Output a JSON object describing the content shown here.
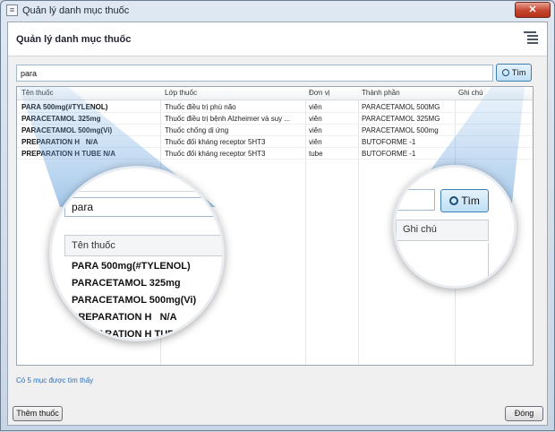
{
  "window": {
    "title": "Quản lý danh mục thuốc",
    "close_label": "✕"
  },
  "header": {
    "title": "Quản lý danh mục thuốc"
  },
  "search": {
    "value": "para",
    "button_label": "Tìm"
  },
  "table": {
    "columns": [
      "Tên thuốc",
      "Lớp thuốc",
      "Đơn vị",
      "Thành phần",
      "Ghi chú"
    ],
    "rows": [
      {
        "name": "PARA 500mg(#TYLENOL)",
        "class": "Thuốc điều trị phù não",
        "unit": "viên",
        "ingredient": "PARACETAMOL 500MG",
        "note": ""
      },
      {
        "name": "PARACETAMOL 325mg",
        "class": "Thuốc điều trị bệnh Alzheimer và suy ...",
        "unit": "viên",
        "ingredient": "PARACETAMOL 325MG",
        "note": ""
      },
      {
        "name": "PARACETAMOL 500mg(Vi)",
        "class": "Thuốc chống dị ứng",
        "unit": "viên",
        "ingredient": "PARACETAMOL 500mg",
        "note": ""
      },
      {
        "name": "PREPARATION H   N/A",
        "class": "Thuốc đối kháng receptor 5HT3",
        "unit": "viên",
        "ingredient": "BUTOFORME -1",
        "note": ""
      },
      {
        "name": "PREPARATION H TUBE N/A",
        "class": "Thuốc đối kháng receptor 5HT3",
        "unit": "tube",
        "ingredient": "BUTOFORME -1",
        "note": ""
      }
    ]
  },
  "status": {
    "text": "Có 5 mục được tìm thấy"
  },
  "footer": {
    "add_label": "Thêm thuốc",
    "close_label": "Đóng"
  },
  "zoom_left": {
    "search_value": "para",
    "header": "Tên thuốc",
    "rows": [
      "PARA 500mg(#TYLENOL)",
      "PARACETAMOL 325mg",
      "PARACETAMOL 500mg(Vi)",
      "PREPARATION H   N/A",
      "PREPARATION H TUBE N/A"
    ]
  },
  "zoom_right": {
    "button_label": "Tìm",
    "header": "Ghi chú"
  },
  "icons": {
    "app": "list-icon",
    "menu": "menu-lines-icon",
    "search": "magnifier-icon"
  },
  "colors": {
    "accent": "#2a6ebb",
    "search_button_border": "#3c7fb1",
    "close_button": "#c4452f"
  }
}
